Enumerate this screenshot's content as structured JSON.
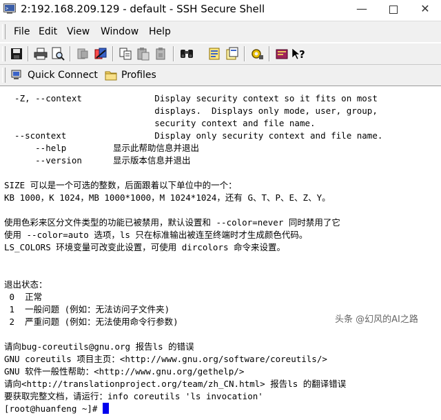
{
  "window": {
    "title": "2:192.168.209.129 - default - SSH Secure Shell"
  },
  "titlebar": {
    "minimize": "—",
    "close": "✕"
  },
  "menu": [
    "File",
    "Edit",
    "View",
    "Window",
    "Help"
  ],
  "toolbar_icons": [
    "save-icon",
    "print-icon",
    "print-preview-icon",
    "disconnect-icon",
    "connect-icon",
    "copy-icon",
    "paste-icon",
    "paste-alt-icon",
    "find-icon",
    "settings-icon",
    "new-window-icon",
    "key-settings-icon",
    "help-book-icon",
    "context-help-icon"
  ],
  "quickbar": {
    "quick_connect": "Quick Connect",
    "profiles": "Profiles"
  },
  "terminal": {
    "lines": [
      "  -Z, --context              Display security context so it fits on most",
      "                             displays.  Displays only mode, user, group,",
      "                             security context and file name.",
      "  --scontext                 Display only security context and file name.",
      "      --help         显示此帮助信息并退出",
      "      --version      显示版本信息并退出",
      "",
      "SIZE 可以是一个可选的整数，后面跟着以下单位中的一个：",
      "KB 1000，K 1024，MB 1000*1000，M 1024*1024，还有 G、T、P、E、Z、Y。",
      "",
      "使用色彩来区分文件类型的功能已被禁用，默认设置和 --color=never 同时禁用了它",
      "使用 --color=auto 选项，ls 只在标准输出被连至终端时才生成颜色代码。",
      "LS_COLORS 环境变量可改变此设置，可使用 dircolors 命令来设置。",
      "",
      "",
      "退出状态：",
      " 0  正常",
      " 1  一般问题 (例如：无法访问子文件夹)",
      " 2  严重问题 (例如：无法使用命令行参数)",
      "",
      "请向bug-coreutils@gnu.org 报告ls 的错误",
      "GNU coreutils 项目主页：<http://www.gnu.org/software/coreutils/>",
      "GNU 软件一般性帮助：<http://www.gnu.org/gethelp/>",
      "请向<http://translationproject.org/team/zh_CN.html> 报告ls 的翻译错误",
      "要获取完整文档，请运行：info coreutils 'ls invocation'"
    ],
    "prompt": "[root@huanfeng ~]# "
  },
  "watermark": "头条 @幻风的AI之路",
  "colors": {
    "cursor": "#0000ee",
    "terminal_bg": "#ffffff",
    "chrome_bg": "#f0f0f0"
  }
}
